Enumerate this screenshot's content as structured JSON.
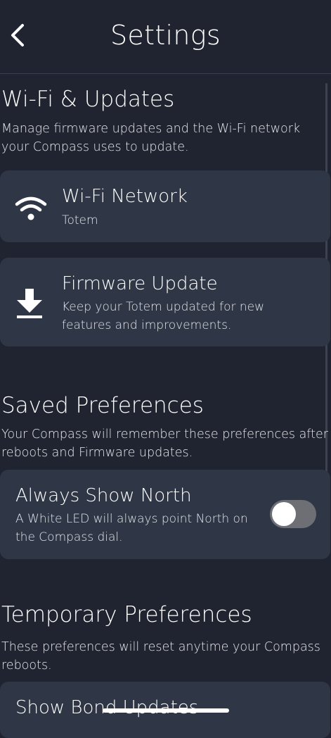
{
  "header": {
    "title": "Settings"
  },
  "wifi_updates": {
    "title": "Wi-Fi & Updates",
    "description": "Manage firmware updates and the Wi-Fi network your Compass uses to update.",
    "wifi_card": {
      "icon": "wifi-icon",
      "title": "Wi-Fi Network",
      "subtitle": "Totem"
    },
    "firmware_card": {
      "icon": "download-icon",
      "title": "Firmware Update",
      "subtitle": "Keep your Totem updated for new features and improvements."
    }
  },
  "saved_preferences": {
    "title": "Saved Preferences",
    "description": "Your Compass will remember these preferences after reboots and Firmware updates.",
    "north_card": {
      "title": "Always Show North",
      "subtitle": "A White LED will always point North on the Compass dial.",
      "toggle_on": false
    }
  },
  "temporary_preferences": {
    "title": "Temporary Preferences",
    "description": "These preferences will reset anytime your Compass reboots.",
    "bond_card": {
      "title": "Show Bond Updates"
    }
  },
  "colors": {
    "background": "#1f2430",
    "card": "#2f3747",
    "toggle_off": "#6e6f75"
  }
}
